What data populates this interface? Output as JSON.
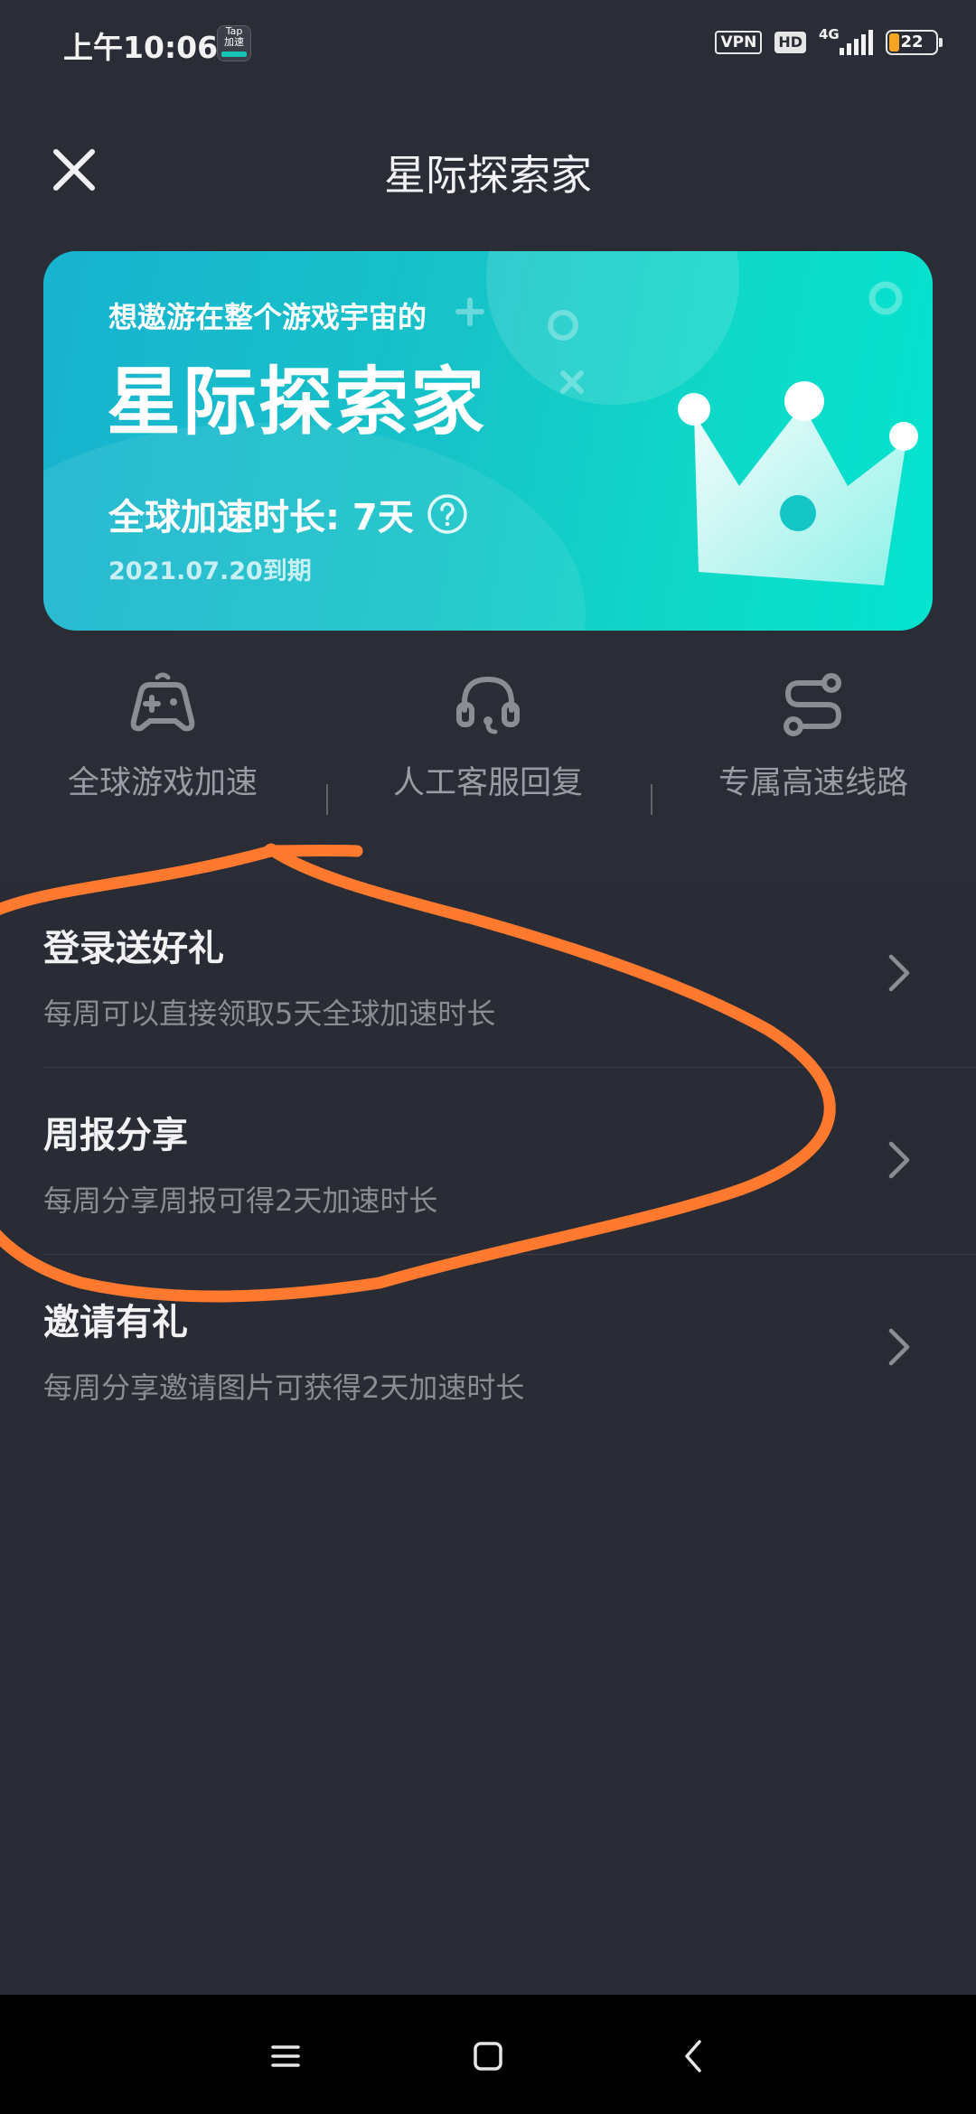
{
  "status_bar": {
    "time": "上午10:06",
    "app_icon_text_top": "Tap",
    "app_icon_text_bottom": "加速",
    "vpn": "VPN",
    "hd": "HD",
    "network": "4G",
    "battery": "22",
    "battery_level_percent": 22
  },
  "header": {
    "title": "星际探索家",
    "close_icon": "close-icon"
  },
  "banner": {
    "slogan": "想遨游在整个游戏宇宙的",
    "title": "星际探索家",
    "duration": "全球加速时长: 7天",
    "expiry": "2021.07.20到期",
    "help_icon": "question-circle-icon"
  },
  "features": [
    {
      "label": "全球游戏加速",
      "icon": "gamepad-icon"
    },
    {
      "label": "人工客服回复",
      "icon": "headset-icon"
    },
    {
      "label": "专属高速线路",
      "icon": "route-icon"
    }
  ],
  "list": [
    {
      "title": "登录送好礼",
      "desc": "每周可以直接领取5天全球加速时长"
    },
    {
      "title": "周报分享",
      "desc": "每周分享周报可得2天加速时长"
    },
    {
      "title": "邀请有礼",
      "desc": "每周分享邀请图片可获得2天加速时长"
    }
  ],
  "colors": {
    "background": "#2b2d36",
    "banner_start": "#18b3cf",
    "banner_end": "#03e4cf",
    "annotation": "#ff7a2f"
  }
}
